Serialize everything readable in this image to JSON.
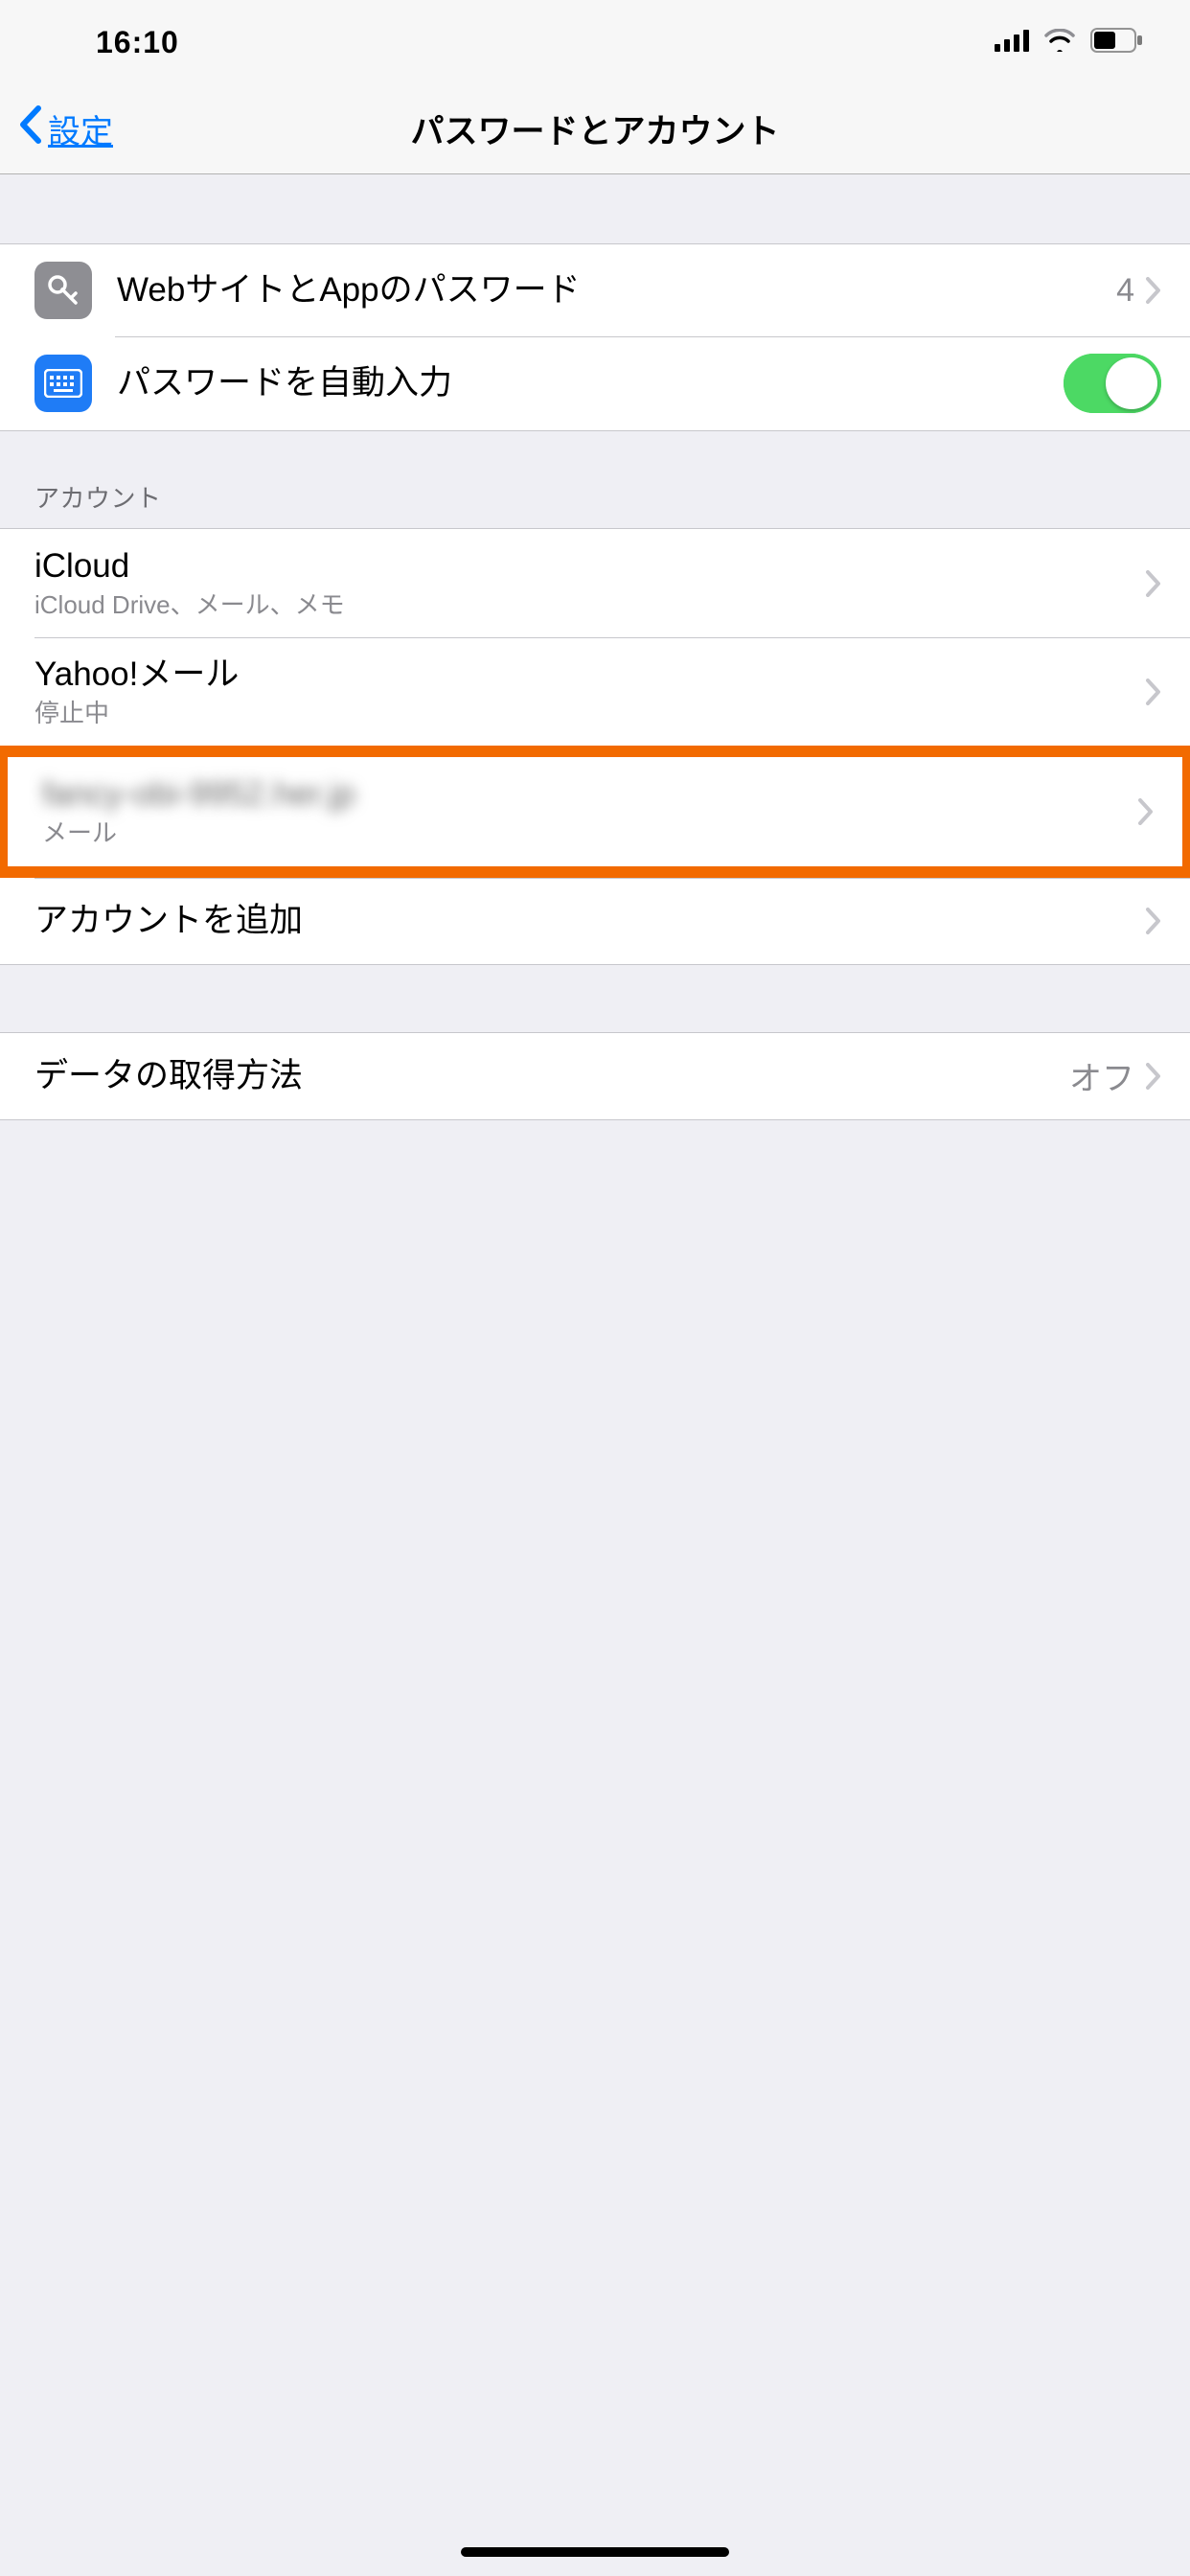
{
  "status": {
    "time": "16:10"
  },
  "nav": {
    "back": "設定",
    "title": "パスワードとアカウント"
  },
  "passwords": {
    "websites_label": "WebサイトとAppのパスワード",
    "websites_count": "4",
    "autofill_label": "パスワードを自動入力",
    "autofill_on": true
  },
  "accounts_header": "アカウント",
  "accounts": [
    {
      "title": "iCloud",
      "sub": "iCloud Drive、メール、メモ"
    },
    {
      "title": "Yahoo!メール",
      "sub": "停止中"
    },
    {
      "title": "fancy-obi-9952.her.jp",
      "sub": "メール",
      "highlighted": true,
      "blurred": true
    }
  ],
  "add_account_label": "アカウントを追加",
  "fetch": {
    "label": "データの取得方法",
    "value": "オフ"
  }
}
